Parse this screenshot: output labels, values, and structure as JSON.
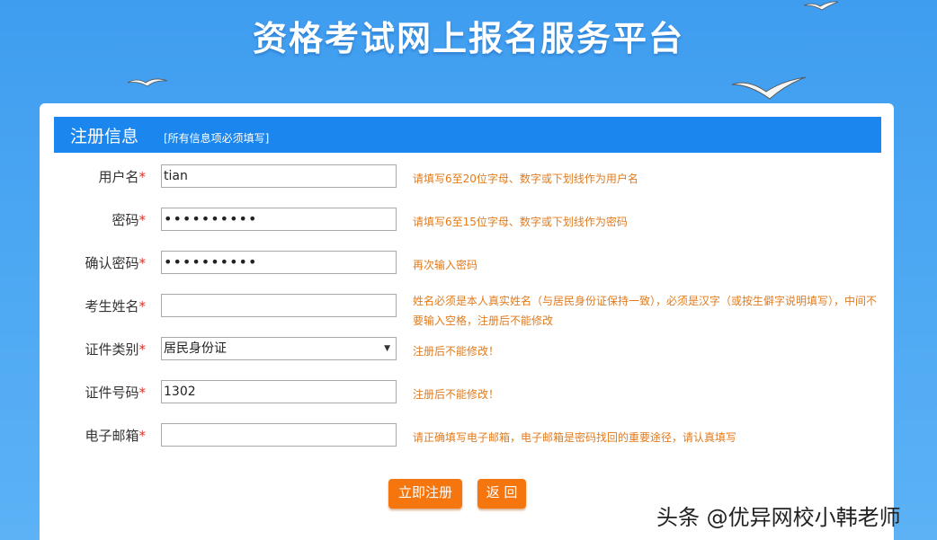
{
  "site": {
    "title": "资格考试网上报名服务平台"
  },
  "form": {
    "header_title": "注册信息",
    "header_note": "[所有信息项必须填写]",
    "required_mark": "*",
    "fields": [
      {
        "label": "用户名",
        "value": "tian",
        "hint": "请填写6至20位字母、数字或下划线作为用户名"
      },
      {
        "label": "密码",
        "value": "••••••••••",
        "hint": "请填写6至15位字母、数字或下划线作为密码"
      },
      {
        "label": "确认密码",
        "value": "••••••••••",
        "hint": "再次输入密码"
      },
      {
        "label": "考生姓名",
        "value": "",
        "hint": "姓名必须是本人真实姓名（与居民身份证保持一致），必须是汉字（或按生僻字说明填写），中间不要输入空格，注册后不能修改"
      },
      {
        "label": "证件类别",
        "value": "居民身份证",
        "hint": "注册后不能修改！"
      },
      {
        "label": "证件号码",
        "value": "1302",
        "hint": "注册后不能修改！"
      },
      {
        "label": "电子邮箱",
        "value": "",
        "hint": "请正确填写电子邮箱，电子邮箱是密码找回的重要途径，请认真填写"
      }
    ],
    "submit_label": "立即注册",
    "back_label": "返 回"
  },
  "watermark": "头条 @优异网校小韩老师",
  "colors": {
    "header_blue": "#1a86ee",
    "button_orange": "#f5750e",
    "hint_orange": "#e07b1e",
    "required_red": "#e0302c"
  }
}
